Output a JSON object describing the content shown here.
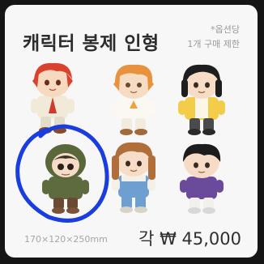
{
  "product": {
    "title": "캐릭터 봉제 인형",
    "note_line1": "*옵션당",
    "note_line2": "1개 구매 제한",
    "size": "170×120×250mm",
    "price": "각 ₩ 45,000"
  },
  "colors": {
    "card_background": "#f7f7f7",
    "frame": "#151515",
    "highlight_circle": "#1a3de0"
  },
  "icons": [
    "plush-red-hair",
    "plush-orange-hair",
    "plush-black-hair-yellow-coat",
    "plush-green-hood",
    "plush-brown-hair-overalls",
    "plush-black-hair-purple-shirt"
  ]
}
